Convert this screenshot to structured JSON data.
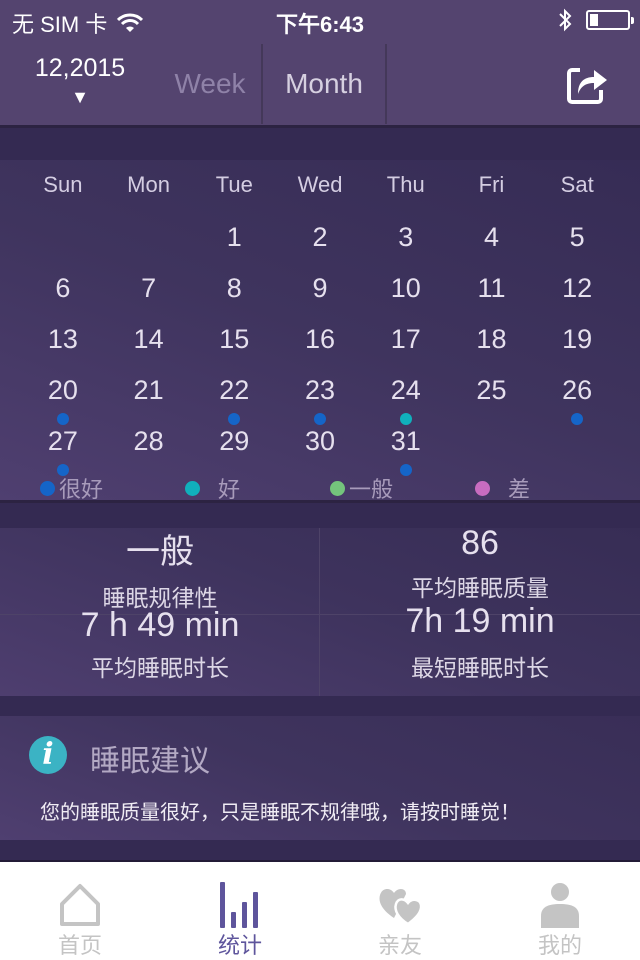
{
  "status_bar": {
    "carrier": "无 SIM 卡",
    "time": "下午6:43",
    "battery_level": 0.2
  },
  "header": {
    "date": "12,2015",
    "dropdown_arrow": "▼",
    "tabs": [
      "Week",
      "Month"
    ],
    "active_tab": "Month",
    "share_icon": "share-icon"
  },
  "calendar": {
    "weekdays": [
      "Sun",
      "Mon",
      "Tue",
      "Wed",
      "Thu",
      "Fri",
      "Sat"
    ],
    "weeks": [
      [
        {
          "d": ""
        },
        {
          "d": ""
        },
        {
          "d": "1"
        },
        {
          "d": "2"
        },
        {
          "d": "3"
        },
        {
          "d": "4"
        },
        {
          "d": "5"
        }
      ],
      [
        {
          "d": "6"
        },
        {
          "d": "7"
        },
        {
          "d": "8"
        },
        {
          "d": "9"
        },
        {
          "d": "10"
        },
        {
          "d": "11"
        },
        {
          "d": "12"
        }
      ],
      [
        {
          "d": "13"
        },
        {
          "d": "14"
        },
        {
          "d": "15"
        },
        {
          "d": "16"
        },
        {
          "d": "17"
        },
        {
          "d": "18"
        },
        {
          "d": "19"
        }
      ],
      [
        {
          "d": "20",
          "q": "very_good"
        },
        {
          "d": "21"
        },
        {
          "d": "22",
          "q": "very_good"
        },
        {
          "d": "23",
          "q": "very_good"
        },
        {
          "d": "24",
          "q": "good"
        },
        {
          "d": "25"
        },
        {
          "d": "26",
          "q": "very_good"
        }
      ],
      [
        {
          "d": "27",
          "q": "very_good"
        },
        {
          "d": "28"
        },
        {
          "d": "29"
        },
        {
          "d": "30"
        },
        {
          "d": "31",
          "q": "very_good"
        },
        {
          "d": ""
        },
        {
          "d": ""
        }
      ]
    ],
    "legend": [
      {
        "key": "very_good",
        "label": "很好",
        "color": "#1565c8"
      },
      {
        "key": "good",
        "label": "好",
        "color": "#10b0bc"
      },
      {
        "key": "average",
        "label": "一般",
        "color": "#74c47c"
      },
      {
        "key": "poor",
        "label": "差",
        "color": "#c86cc0"
      }
    ]
  },
  "stats": {
    "regularity": {
      "value": "一般",
      "label": "睡眠规律性"
    },
    "avg_quality": {
      "value": "86",
      "label": "平均睡眠质量"
    },
    "avg_duration": {
      "value": "7 h  49 min",
      "label": "平均睡眠时长"
    },
    "min_duration": {
      "value": "7h  19 min",
      "label": "最短睡眠时长"
    }
  },
  "advice": {
    "title": "睡眠建议",
    "icon_letter": "i",
    "text": "您的睡眠质量很好，只是睡眠不规律哦，请按时睡觉！"
  },
  "tabbar": {
    "items": [
      {
        "label": "首页",
        "icon": "home-icon"
      },
      {
        "label": "统计",
        "icon": "stats-icon",
        "active": true
      },
      {
        "label": "亲友",
        "icon": "hearts-icon"
      },
      {
        "label": "我的",
        "icon": "user-icon"
      }
    ],
    "active_color": "#5e559c",
    "inactive_color": "#c4c4c4"
  }
}
